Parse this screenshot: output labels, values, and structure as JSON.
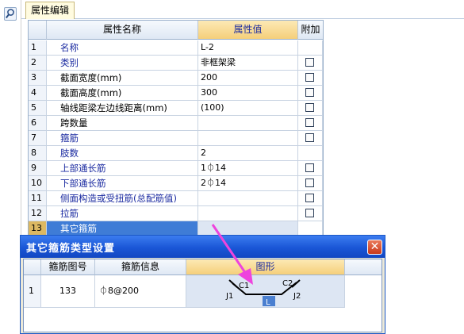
{
  "tab": {
    "label": "属性编辑"
  },
  "grid": {
    "headers": {
      "name": "属性名称",
      "value": "属性值",
      "extra": "附加"
    },
    "rows": [
      {
        "no": "1",
        "name": "名称",
        "value": "L-2",
        "blue": true,
        "check": false
      },
      {
        "no": "2",
        "name": "类别",
        "value": "非框架梁",
        "blue": true,
        "check": true
      },
      {
        "no": "3",
        "name": "截面宽度(mm)",
        "value": "200",
        "blue": false,
        "check": true
      },
      {
        "no": "4",
        "name": "截面高度(mm)",
        "value": "300",
        "blue": false,
        "check": true
      },
      {
        "no": "5",
        "name": "轴线距梁左边线距离(mm)",
        "value": "(100)",
        "blue": false,
        "check": true
      },
      {
        "no": "6",
        "name": "跨数量",
        "value": "",
        "blue": false,
        "check": true
      },
      {
        "no": "7",
        "name": "箍筋",
        "value": "",
        "blue": true,
        "check": true
      },
      {
        "no": "8",
        "name": "肢数",
        "value": "2",
        "blue": true,
        "check": false
      },
      {
        "no": "9",
        "name": "上部通长筋",
        "value": "1⏀14",
        "blue": true,
        "check": true
      },
      {
        "no": "10",
        "name": "下部通长筋",
        "value": "2⏀14",
        "blue": true,
        "check": true
      },
      {
        "no": "11",
        "name": "侧面构造或受扭筋(总配筋值)",
        "value": "",
        "blue": true,
        "check": true
      },
      {
        "no": "12",
        "name": "拉筋",
        "value": "",
        "blue": true,
        "check": true
      },
      {
        "no": "13",
        "name": "其它箍筋",
        "value": "",
        "blue": false,
        "check": false,
        "selected": true
      }
    ]
  },
  "dialog": {
    "title": "其它箍筋类型设置",
    "headers": {
      "fig_no": "箍筋图号",
      "info": "箍筋信息",
      "figure": "图形"
    },
    "row": {
      "no": "1",
      "fig_no": "133",
      "info": "⏀8@200"
    },
    "figure_labels": {
      "c1": "C1",
      "c2": "C2",
      "j1": "J1",
      "j2": "J2",
      "l": "L"
    }
  },
  "colors": {
    "selected_row": "#3f7cd6",
    "header_value": "#f5cf7a",
    "arrow": "#ee44dd",
    "dialog_title": "#1a56d6"
  }
}
